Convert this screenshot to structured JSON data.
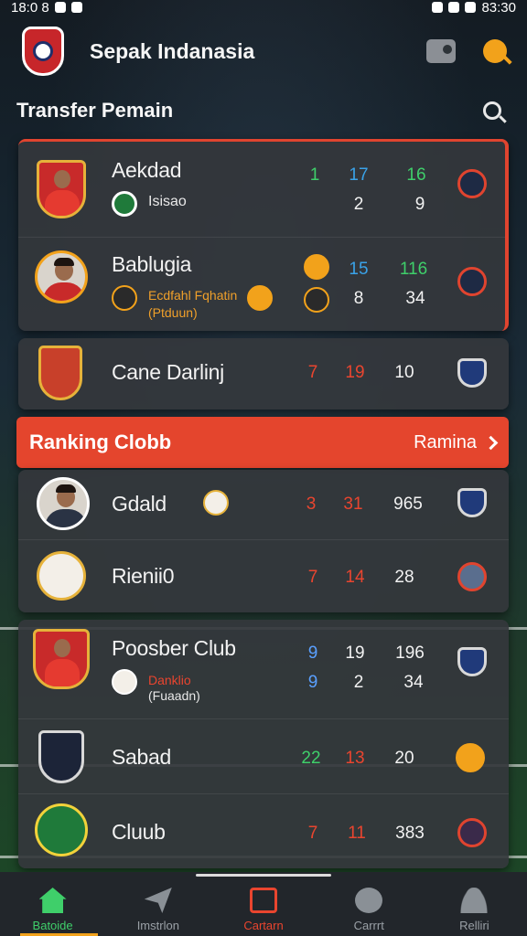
{
  "status": {
    "time": "18:0 8",
    "battery": "83:30"
  },
  "header": {
    "title": "Sepak Indanasia"
  },
  "transfer": {
    "title": "Transfer Pemain",
    "players": [
      {
        "name": "Aekdad",
        "sub": "Isisao",
        "stats": [
          "1",
          "17",
          "16"
        ],
        "stats2": [
          "2",
          "9"
        ]
      },
      {
        "name": "Bablugia",
        "sub": "Ecdfahl Fqhatin",
        "sub2": "(Ptduun)",
        "stats": [
          "15",
          "116"
        ],
        "stats2": [
          "8",
          "34"
        ]
      },
      {
        "name": "Cane Darlinj",
        "stats": [
          "7",
          "19",
          "10"
        ]
      }
    ]
  },
  "ranking": {
    "title": "Ranking Clobb",
    "more": "Ramina",
    "clubs": [
      {
        "name": "Gdald",
        "stats": [
          "3",
          "31",
          "965"
        ]
      },
      {
        "name": "Rienii0",
        "stats": [
          "7",
          "14",
          "28"
        ]
      },
      {
        "name": "Poosber Club",
        "sub": "Danklio",
        "sub2": "(Fuaadn)",
        "stats": [
          "9",
          "19",
          "196"
        ],
        "stats2": [
          "9",
          "2",
          "34"
        ]
      },
      {
        "name": "Sabad",
        "stats": [
          "22",
          "13",
          "20"
        ]
      },
      {
        "name": "Cluub",
        "stats": [
          "7",
          "11",
          "383"
        ]
      }
    ]
  },
  "nav": [
    {
      "label": "Batoide",
      "icon": "home-icon"
    },
    {
      "label": "Imstrlon",
      "icon": "send-icon"
    },
    {
      "label": "Cartarn",
      "icon": "calendar-icon"
    },
    {
      "label": "Carrrt",
      "icon": "ball-icon"
    },
    {
      "label": "Relliri",
      "icon": "user-icon"
    }
  ],
  "colors": {
    "accent": "#e4452d",
    "green": "#3fcf6a",
    "cyan": "#3aa2e8",
    "gold": "#f2a21b"
  }
}
